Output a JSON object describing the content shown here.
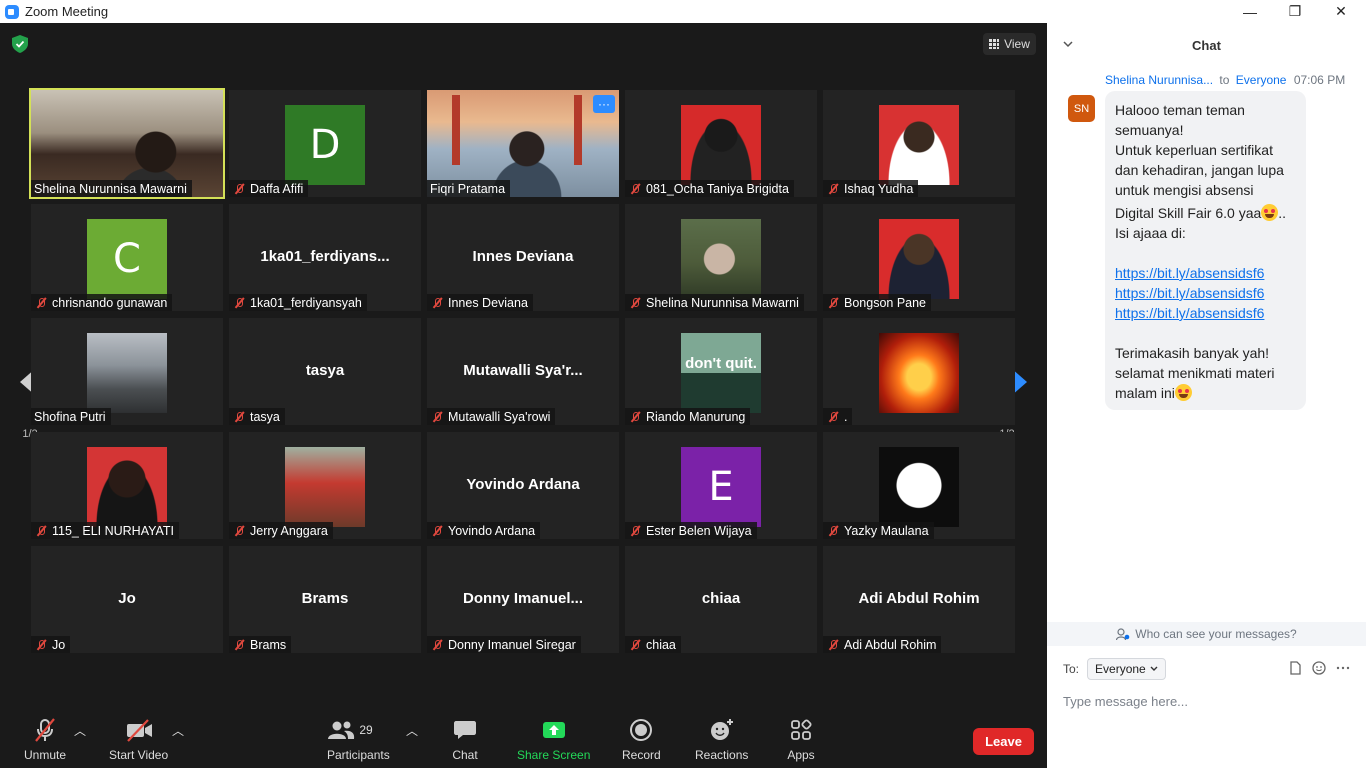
{
  "window": {
    "title": "Zoom Meeting",
    "minimize": "—",
    "restore": "❐",
    "close": "✕"
  },
  "meeting": {
    "view_label": "View",
    "page_indicator_left": "1/2",
    "page_indicator_right": "1/2",
    "participants": [
      {
        "label": "Shelina Nurunnisa Mawarni",
        "kind": "video",
        "muted": false,
        "active": true
      },
      {
        "label": "Daffa Afifi",
        "kind": "initial",
        "initial": "D",
        "color": "#2f7a26",
        "muted": true
      },
      {
        "label": "Fiqri Pratama",
        "kind": "video",
        "muted": false,
        "more": "···"
      },
      {
        "label": "081_Ocha Taniya Brigidta",
        "kind": "photo",
        "muted": true
      },
      {
        "label": "Ishaq Yudha",
        "kind": "photo",
        "muted": true
      },
      {
        "label": "chrisnando gunawan",
        "kind": "initial",
        "initial": "C",
        "color": "#6cab34",
        "muted": true
      },
      {
        "label": "1ka01_ferdiyansyah",
        "kind": "name",
        "display": "1ka01_ferdiyans...",
        "muted": true
      },
      {
        "label": "Innes Deviana",
        "kind": "name",
        "display": "Innes Deviana",
        "muted": true
      },
      {
        "label": "Shelina Nurunnisa Mawarni",
        "kind": "photo",
        "muted": true
      },
      {
        "label": "Bongson Pane",
        "kind": "photo",
        "muted": true
      },
      {
        "label": "Shofina Putri",
        "kind": "photo",
        "muted": false
      },
      {
        "label": "tasya",
        "kind": "name",
        "display": "tasya",
        "muted": true
      },
      {
        "label": "Mutawalli Sya'rowi",
        "kind": "name",
        "display": "Mutawalli  Sya'r...",
        "muted": true
      },
      {
        "label": "Riando Manurung",
        "kind": "photo",
        "muted": true,
        "photo_text": "don't quit."
      },
      {
        "label": ".",
        "kind": "photo",
        "muted": true
      },
      {
        "label": "115_ ELI NURHAYATI",
        "kind": "photo",
        "muted": true
      },
      {
        "label": "Jerry Anggara",
        "kind": "photo",
        "muted": true
      },
      {
        "label": "Yovindo Ardana",
        "kind": "name",
        "display": "Yovindo Ardana",
        "muted": true
      },
      {
        "label": "Ester Belen Wijaya",
        "kind": "initial",
        "initial": "E",
        "color": "#7b22a8",
        "muted": true
      },
      {
        "label": "Yazky Maulana",
        "kind": "photo",
        "muted": true
      },
      {
        "label": "Jo",
        "kind": "name",
        "display": "Jo",
        "muted": true
      },
      {
        "label": "Brams",
        "kind": "name",
        "display": "Brams",
        "muted": true
      },
      {
        "label": "Donny Imanuel Siregar",
        "kind": "name",
        "display": "Donny  Imanuel...",
        "muted": true
      },
      {
        "label": "chiaa",
        "kind": "name",
        "display": "chiaa",
        "muted": true
      },
      {
        "label": "Adi Abdul Rohim",
        "kind": "name",
        "display": "Adi Abdul Rohim",
        "muted": true
      }
    ]
  },
  "toolbar": {
    "unmute": "Unmute",
    "start_video": "Start Video",
    "participants": "Participants",
    "participants_count": "29",
    "chat": "Chat",
    "share_screen": "Share Screen",
    "record": "Record",
    "reactions": "Reactions",
    "apps": "Apps",
    "leave": "Leave",
    "share_color": "#23d959"
  },
  "chat": {
    "title": "Chat",
    "sender": "Shelina Nurunnisa...",
    "to_word": "to",
    "recipient": "Everyone",
    "time": "07:06 PM",
    "avatar_initials": "SN",
    "lines": [
      "Halooo teman teman",
      "semuanya!",
      "Untuk keperluan sertifikat",
      "dan kehadiran, jangan lupa",
      "untuk mengisi absensi",
      "Digital Skill Fair 6.0 yaa",
      "..",
      "Isi ajaaa di:",
      "https://bit.ly/absensidsf6",
      "https://bit.ly/absensidsf6",
      "https://bit.ly/absensidsf6",
      "Terimakasih banyak yah!",
      "selamat menikmati materi",
      "malam ini"
    ],
    "who_can_see": "Who can see your messages?",
    "to_label": "To:",
    "to_value": "Everyone",
    "input_placeholder": "Type message here..."
  }
}
